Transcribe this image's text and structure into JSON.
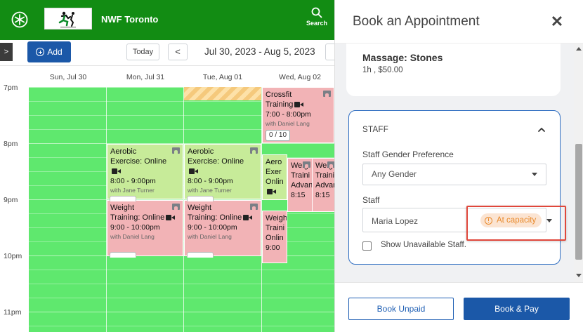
{
  "header": {
    "org_name": "NWF Toronto",
    "search_label": "Search",
    "logo_icon": "runner-logo",
    "app_icon": "snowflake-icon",
    "brand_color": "#128c13"
  },
  "toolbar": {
    "add_label": "Add",
    "today_label": "Today",
    "prev_label": "<",
    "expand_label": ">",
    "date_range": "Jul 30, 2023 - Aug 5, 2023"
  },
  "calendar": {
    "days": [
      "Sun, Jul 30",
      "Mon, Jul 31",
      "Tue, Aug 01",
      "Wed, Aug 02"
    ],
    "times": [
      "7pm",
      "8pm",
      "9pm",
      "10pm",
      "11pm"
    ],
    "events": [
      {
        "title_1": "Crossfit",
        "title_2": "Training",
        "time": "7:00 - 8:00pm",
        "with": "with Daniel Lang",
        "capacity": "0 / 10",
        "color": "#f2b3b6"
      },
      {
        "title_1": "Aerobic",
        "title_2": "Exercise: Online",
        "time": "8:00 - 9:00pm",
        "with": "with Jane Turner",
        "color": "#c7eb99"
      },
      {
        "title_1": "Aerobic",
        "title_2": "Exercise: Online",
        "time": "8:00 - 9:00pm",
        "with": "with Jane Turner",
        "color": "#c7eb99"
      },
      {
        "title_1": "Weight",
        "title_2": "Training: Online",
        "time": "9:00 - 10:00pm",
        "with": "with Daniel Lang",
        "color": "#f2b3b6"
      },
      {
        "title_1": "Weight",
        "title_2": "Training: Online",
        "time": "9:00 - 10:00pm",
        "with": "with Daniel Lang",
        "color": "#f2b3b6"
      },
      {
        "title_1": "Aero",
        "title_2": "Exer",
        "title_3": "Onlin",
        "color": "#c7eb99"
      },
      {
        "title_1": "Weig",
        "title_2": "Traini",
        "title_3": "Advan",
        "time": "8:15",
        "color": "#f2b3b6"
      },
      {
        "title_1": "Weig",
        "title_2": "Traini",
        "title_3": "Advan",
        "time": "8:15",
        "color": "#f2b3b6"
      },
      {
        "title_1": "Weigh",
        "title_2": "Traini",
        "title_3": "Onlin",
        "time": "9:00",
        "color": "#f2b3b6"
      }
    ]
  },
  "panel": {
    "title": "Book an Appointment",
    "close_label": "✕",
    "service": {
      "name": "Massage: Stones",
      "meta": "1h , $50.00"
    },
    "staff_section": {
      "heading": "STAFF",
      "gender_label": "Staff Gender Preference",
      "gender_value": "Any Gender",
      "staff_label": "Staff",
      "staff_value": "Maria Lopez",
      "status_badge": "At capacity",
      "status_color": "#e98a2b",
      "show_unavailable_label": "Show Unavailable Staff."
    },
    "footer": {
      "book_unpaid_label": "Book Unpaid",
      "book_pay_label": "Book & Pay"
    }
  }
}
